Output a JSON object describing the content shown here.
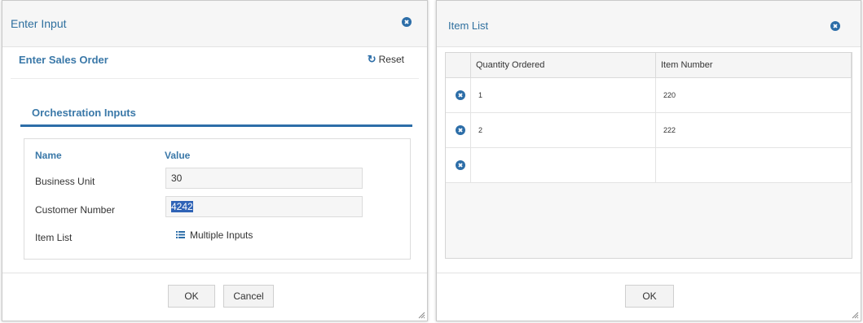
{
  "left_dialog": {
    "title": "Enter Input",
    "section_title": "Enter Sales Order",
    "reset_label": "Reset",
    "tab_label": "Orchestration Inputs",
    "name_header": "Name",
    "value_header": "Value",
    "rows": [
      {
        "label": "Business Unit",
        "value": "30"
      },
      {
        "label": "Customer Number",
        "value": "4242"
      },
      {
        "label": "Item List",
        "link": "Multiple Inputs"
      }
    ],
    "ok_label": "OK",
    "cancel_label": "Cancel"
  },
  "right_dialog": {
    "title": "Item List",
    "columns": [
      "Quantity Ordered",
      "Item Number"
    ],
    "rows": [
      {
        "quantity": "1",
        "item": "220"
      },
      {
        "quantity": "2",
        "item": "222"
      },
      {
        "quantity": "",
        "item": ""
      }
    ],
    "ok_label": "OK"
  },
  "colors": {
    "accent": "#2d6ea8",
    "heading": "#3a78a8",
    "selection": "#2f63b6"
  },
  "icons": [
    "close-icon",
    "refresh-icon",
    "list-icon",
    "resize-grip-icon"
  ]
}
